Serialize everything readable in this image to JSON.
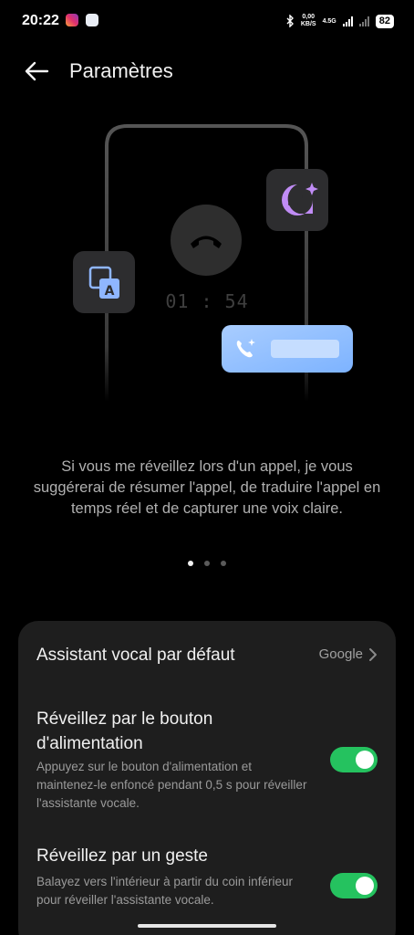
{
  "status_bar": {
    "time": "20:22",
    "speed_value": "0,00",
    "speed_unit": "KB/S",
    "network": "4.5G",
    "battery": "82"
  },
  "header": {
    "back_icon": "arrow-left-icon",
    "title": "Paramètres"
  },
  "illustration": {
    "call_timer": "01 : 54",
    "icons": [
      "translate-icon",
      "summary-sparkle-icon",
      "hang-up-icon",
      "call-sparkle-icon"
    ]
  },
  "description": "Si vous me réveillez lors d'un appel, je vous suggérerai de résumer l'appel, de traduire l'appel en temps réel et de capturer une voix claire.",
  "pagination": {
    "count": 3,
    "active": 0
  },
  "settings": {
    "default_assistant": {
      "label": "Assistant vocal par défaut",
      "value": "Google"
    },
    "power_button": {
      "title": "Réveillez par le bouton d'alimentation",
      "description": "Appuyez sur le bouton d'alimentation et maintenez-le enfoncé pendant 0,5 s pour réveiller l'assistante vocale.",
      "enabled": true
    },
    "gesture": {
      "title": "Réveillez par un geste",
      "description": "Balayez vers l'intérieur à partir du coin inférieur pour réveiller l'assistante vocale.",
      "enabled": true
    }
  },
  "colors": {
    "toggle_on": "#25c25f",
    "summary_icon": "#c08cf5",
    "call_card": "#9ec6ff"
  }
}
